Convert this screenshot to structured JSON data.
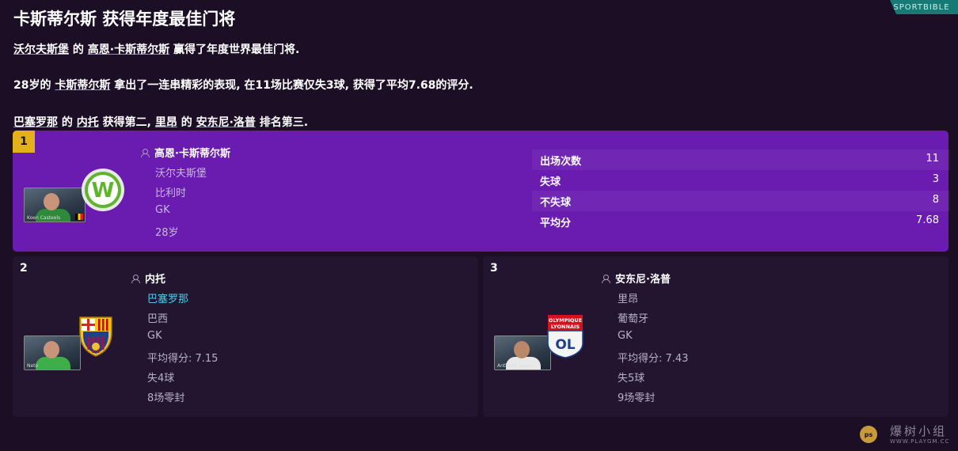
{
  "header": {
    "title": "卡斯蒂尔斯 获得年度最佳门将",
    "tag": "SPORTBIBLE"
  },
  "paragraphs": {
    "p1": {
      "club": "沃尔夫斯堡",
      "a": " 的 ",
      "player": "高恩·卡斯蒂尔斯",
      "b": " 赢得了年度世界最佳门将."
    },
    "p2": {
      "age": "28岁的 ",
      "player": "卡斯蒂尔斯",
      "b": " 拿出了一连串精彩的表现, 在11场比赛仅失3球, 获得了平均7.68的评分."
    },
    "p3": {
      "club2": "巴塞罗那",
      "a": " 的 ",
      "p2": "内托",
      "b": " 获得第二, ",
      "club3": "里昂",
      "c": " 的 ",
      "p3": "安东尼·洛普",
      "d": " 排名第三."
    }
  },
  "first": {
    "rank": "1",
    "name": "高恩·卡斯蒂尔斯",
    "club": "沃尔夫斯堡",
    "nation": "比利时",
    "position": "GK",
    "age": "28岁",
    "photo_caption": "Koen Casteels",
    "stats": [
      {
        "label": "出场次数",
        "value": "11"
      },
      {
        "label": "失球",
        "value": "3"
      },
      {
        "label": "不失球",
        "value": "8"
      },
      {
        "label": "平均分",
        "value": "7.68"
      }
    ]
  },
  "second": {
    "rank": "2",
    "name": "内托",
    "club": "巴塞罗那",
    "nation": "巴西",
    "position": "GK",
    "avg": "平均得分: 7.15",
    "conceded": "失4球",
    "cleansheets": "8场零封",
    "photo_caption": "Neto"
  },
  "third": {
    "rank": "3",
    "name": "安东尼·洛普",
    "club": "里昂",
    "nation": "葡萄牙",
    "position": "GK",
    "avg": "平均得分: 7.43",
    "conceded": "失5球",
    "cleansheets": "9场零封",
    "photo_caption": "Anthony Lopes",
    "badge_top": "OLYMPIQUE",
    "badge_bottom": "LYONNAIS",
    "badge_letters": "OL"
  },
  "watermark": {
    "text": "爆树小组",
    "url": "WWW.PLAYGM.CC",
    "logo": "ps"
  },
  "colors": {
    "background": "#1b0e25",
    "winner_card": "#6a1bb0",
    "rank1_badge": "#e3b21b",
    "card": "#231530",
    "link": "#55c8e8",
    "tag": "#177a74"
  }
}
